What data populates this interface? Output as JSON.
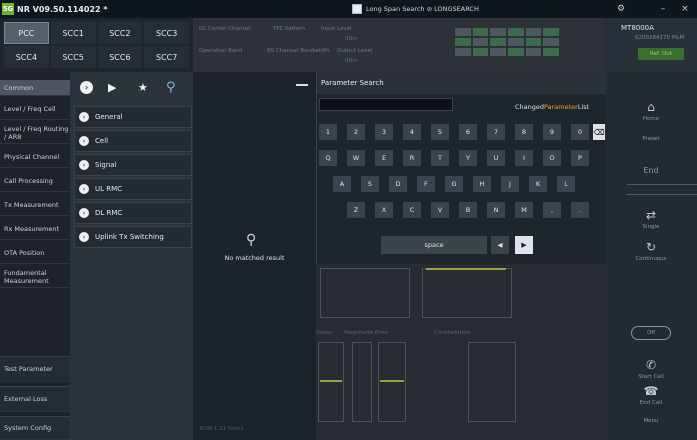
{
  "titlebar": {
    "logo": "5G",
    "title": "NR V09.50.114022 *",
    "center": "Long Span Search ⊘ LONGSEARCH",
    "gear": "⚙",
    "minimize": "–",
    "close": "×"
  },
  "carrier_tabs": [
    "PCC",
    "SCC1",
    "SCC2",
    "SCC3",
    "SCC4",
    "SCC5",
    "SCC6",
    "SCC7"
  ],
  "info": {
    "dl_center_channel": "DL Center Channel",
    "tpc_pattern": "TPC Pattern",
    "input_level": "Input Level",
    "operation_band": "Operation Band",
    "channel_bandwidth": "BS Channel Bandwidth",
    "output_level": "Output Level",
    "dbm_1": "dBm",
    "dbm_2": "dBm"
  },
  "right_panel": {
    "model": "MT8000A",
    "id": "6200284170 P&M",
    "ref_out": "Ref. Out",
    "home": "Home",
    "preset": "Preset",
    "end": "End",
    "single": "Single",
    "continuous": "Continuous",
    "off_label": "Off",
    "start_call": "Start Call",
    "end_call": "End Call",
    "menu": "Menu"
  },
  "categories": [
    "Common",
    "Level / Freq Cell",
    "Level / Freq Routing / AR8",
    "Physical Channel",
    "Call Processing",
    "Tx Measurement",
    "Rx Measurement",
    "OTA Position",
    "Fundamental Measurement",
    "Test Parameter",
    "External Loss",
    "System Config"
  ],
  "submenu": {
    "icons": {
      "expand": "chevron-right-icon",
      "play": "play-list-icon",
      "favorite": "star-icon",
      "search": "search-icon"
    },
    "items": [
      "General",
      "Cell",
      "Signal",
      "UL RMC",
      "DL RMC",
      "Uplink Tx Switching"
    ]
  },
  "results": {
    "empty_text": "No matched result"
  },
  "dialog": {
    "title": "Parameter Search",
    "input_value": "",
    "changed_prefix": "Changed",
    "changed_hl": "Parameter",
    "changed_suffix": "List"
  },
  "keyboard": {
    "row1": [
      "1",
      "2",
      "3",
      "4",
      "5",
      "6",
      "7",
      "8",
      "9",
      "0"
    ],
    "row2": [
      "Q",
      "W",
      "E",
      "R",
      "T",
      "Y",
      "U",
      "I",
      "O",
      "P"
    ],
    "row3": [
      "A",
      "S",
      "D",
      "F",
      "G",
      "H",
      "J",
      "K",
      "L"
    ],
    "row4": [
      "Z",
      "X",
      "C",
      "V",
      "B",
      "N",
      "M",
      ",",
      "."
    ],
    "space": "space",
    "delete": "⌫",
    "left": "◀",
    "right": "▶"
  },
  "measurement": {
    "power": "Power",
    "magnitude_error": "Magnitude Error",
    "constellation": "Constellation",
    "evm": "EVM 1.21 %rms"
  },
  "colors": {
    "accent_green": "#6fb22f",
    "highlight_orange": "#e9a825",
    "background": "#2a2f36"
  }
}
